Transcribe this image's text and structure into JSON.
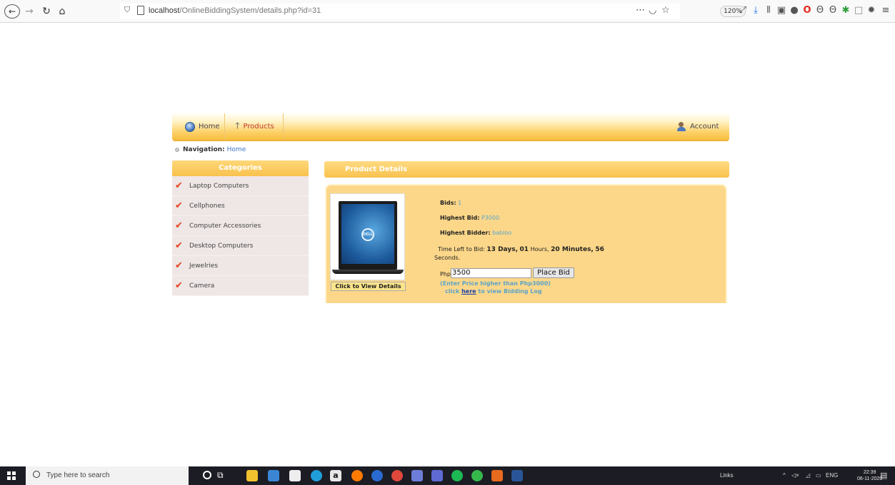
{
  "browser": {
    "url_host": "localhost",
    "url_path": "/OnlineBiddingSystem/details.php?id=31",
    "zoom": "120%"
  },
  "nav": {
    "home": "Home",
    "products": "Products",
    "account": "Account"
  },
  "breadcrumb": {
    "label": "Navigation:",
    "link": "Home"
  },
  "categories": {
    "title": "Categories",
    "items": [
      "Laptop Computers",
      "Cellphones",
      "Computer Accessories",
      "Desktop Computers",
      "Jewelries",
      "Camera"
    ]
  },
  "product": {
    "header": "Product Details",
    "view_details": "Click to View Details",
    "bids_label": "Bids:",
    "bids_value": "1",
    "highest_bid_label": "Highest Bid:",
    "highest_bid_value": "P3000",
    "highest_bidder_label": "Highest Bidder:",
    "highest_bidder_value": "babloo",
    "time_left_label": "Time Left to Bid:",
    "days": "13 Days,",
    "hours_num": "01",
    "hours_unit": "Hours,",
    "minutes": "20 Minutes,",
    "seconds_num": "56",
    "seconds_unit": "Seconds.",
    "php_label": "Php",
    "bid_input_value": "3500",
    "place_bid": "Place Bid",
    "hint": "(Enter Price higher than Php3000)",
    "log_prefix": "click",
    "log_link": "here",
    "log_suffix": "to view Bidding Log"
  },
  "taskbar": {
    "search_placeholder": "Type here to search",
    "links": "Links",
    "lang": "ENG",
    "time": "22:39",
    "date": "06-11-2020"
  }
}
